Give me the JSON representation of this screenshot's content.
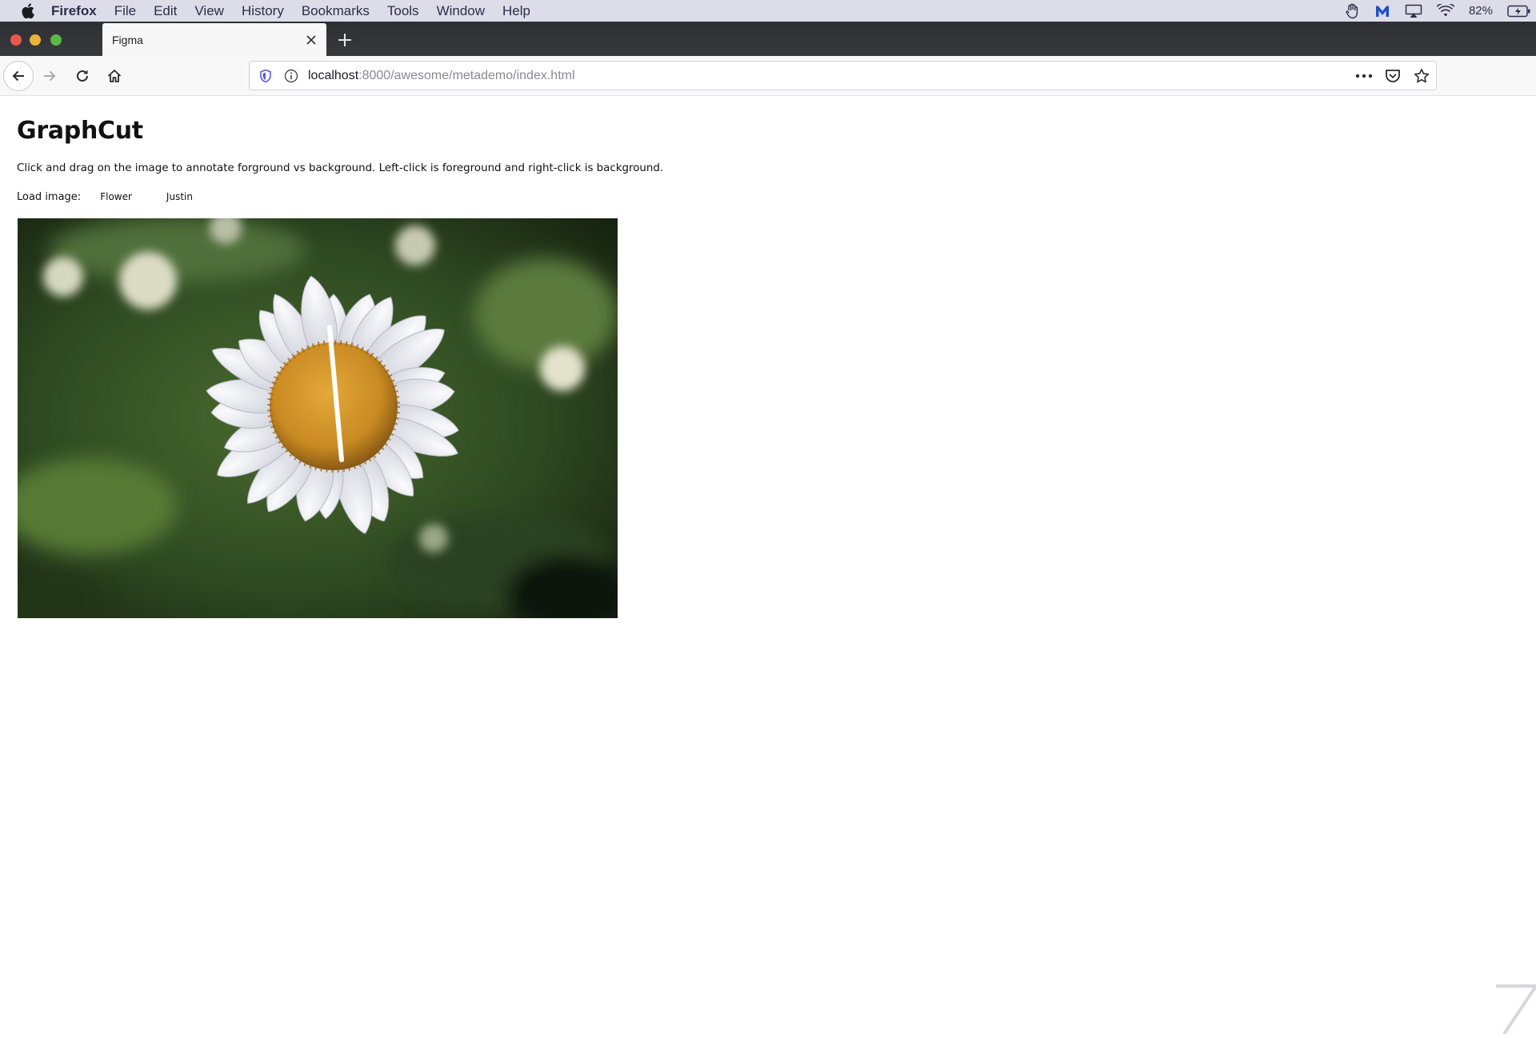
{
  "menubar": {
    "app_name": "Firefox",
    "items": [
      "File",
      "Edit",
      "View",
      "History",
      "Bookmarks",
      "Tools",
      "Window",
      "Help"
    ],
    "battery": "82%"
  },
  "tabs": [
    {
      "title": "Figma",
      "active": true
    }
  ],
  "urlbar": {
    "host": "localhost",
    "path": ":8000/awesome/metademo/index.html"
  },
  "page": {
    "title": "GraphCut",
    "description": "Click and drag on the image to annotate forground vs background. Left-click is foreground and right-click is background.",
    "load_label": "Load image:",
    "buttons": {
      "flower": "Flower",
      "justin": "Justin"
    }
  },
  "canvas": {
    "image": "daisy flower photo",
    "stroke_color": "#ffffff"
  },
  "colors": {
    "menubar_bg": "#dcdde8",
    "tabstrip_bg": "#2e2f33",
    "tab_active_bg": "#f7f7f8",
    "foreground_stroke": "#ffffff"
  }
}
